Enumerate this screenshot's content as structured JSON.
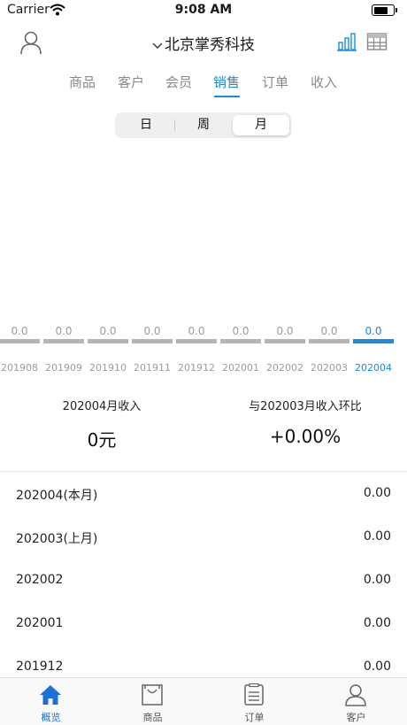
{
  "status_bar": {
    "carrier": "Carrier",
    "time": "9:08 AM"
  },
  "header": {
    "title": "北京掌秀科技"
  },
  "tabs": [
    {
      "label": "商品"
    },
    {
      "label": "客户"
    },
    {
      "label": "会员"
    },
    {
      "label": "销售",
      "active": true
    },
    {
      "label": "订单"
    },
    {
      "label": "收入"
    }
  ],
  "period": {
    "options": [
      "日",
      "周",
      "月"
    ],
    "selected": "月"
  },
  "chart_strip": {
    "columns": [
      {
        "value": "0.0",
        "label": "201908"
      },
      {
        "value": "0.0",
        "label": "201909"
      },
      {
        "value": "0.0",
        "label": "201910"
      },
      {
        "value": "0.0",
        "label": "201911"
      },
      {
        "value": "0.0",
        "label": "201912"
      },
      {
        "value": "0.0",
        "label": "202001"
      },
      {
        "value": "0.0",
        "label": "202002"
      },
      {
        "value": "0.0",
        "label": "202003"
      },
      {
        "value": "0.0",
        "label": "202004",
        "active": true
      }
    ],
    "accent_color": "#1b8be0",
    "inactive_color": "#b5b5b5"
  },
  "summary": {
    "left_label": "202004月收入",
    "left_value": "0元",
    "right_label": "与202003月收入环比",
    "right_value": "+0.00%"
  },
  "rows": [
    {
      "label": "202004(本月)",
      "value": "0.00"
    },
    {
      "label": "202003(上月)",
      "value": "0.00"
    },
    {
      "label": "202002",
      "value": "0.00"
    },
    {
      "label": "202001",
      "value": "0.00"
    },
    {
      "label": "201912",
      "value": "0.00"
    }
  ],
  "tabbar": [
    {
      "label": "概览",
      "icon": "home-icon",
      "active": true
    },
    {
      "label": "商品",
      "icon": "shopping-bag-icon"
    },
    {
      "label": "订单",
      "icon": "order-list-icon"
    },
    {
      "label": "客户",
      "icon": "person-icon"
    }
  ]
}
